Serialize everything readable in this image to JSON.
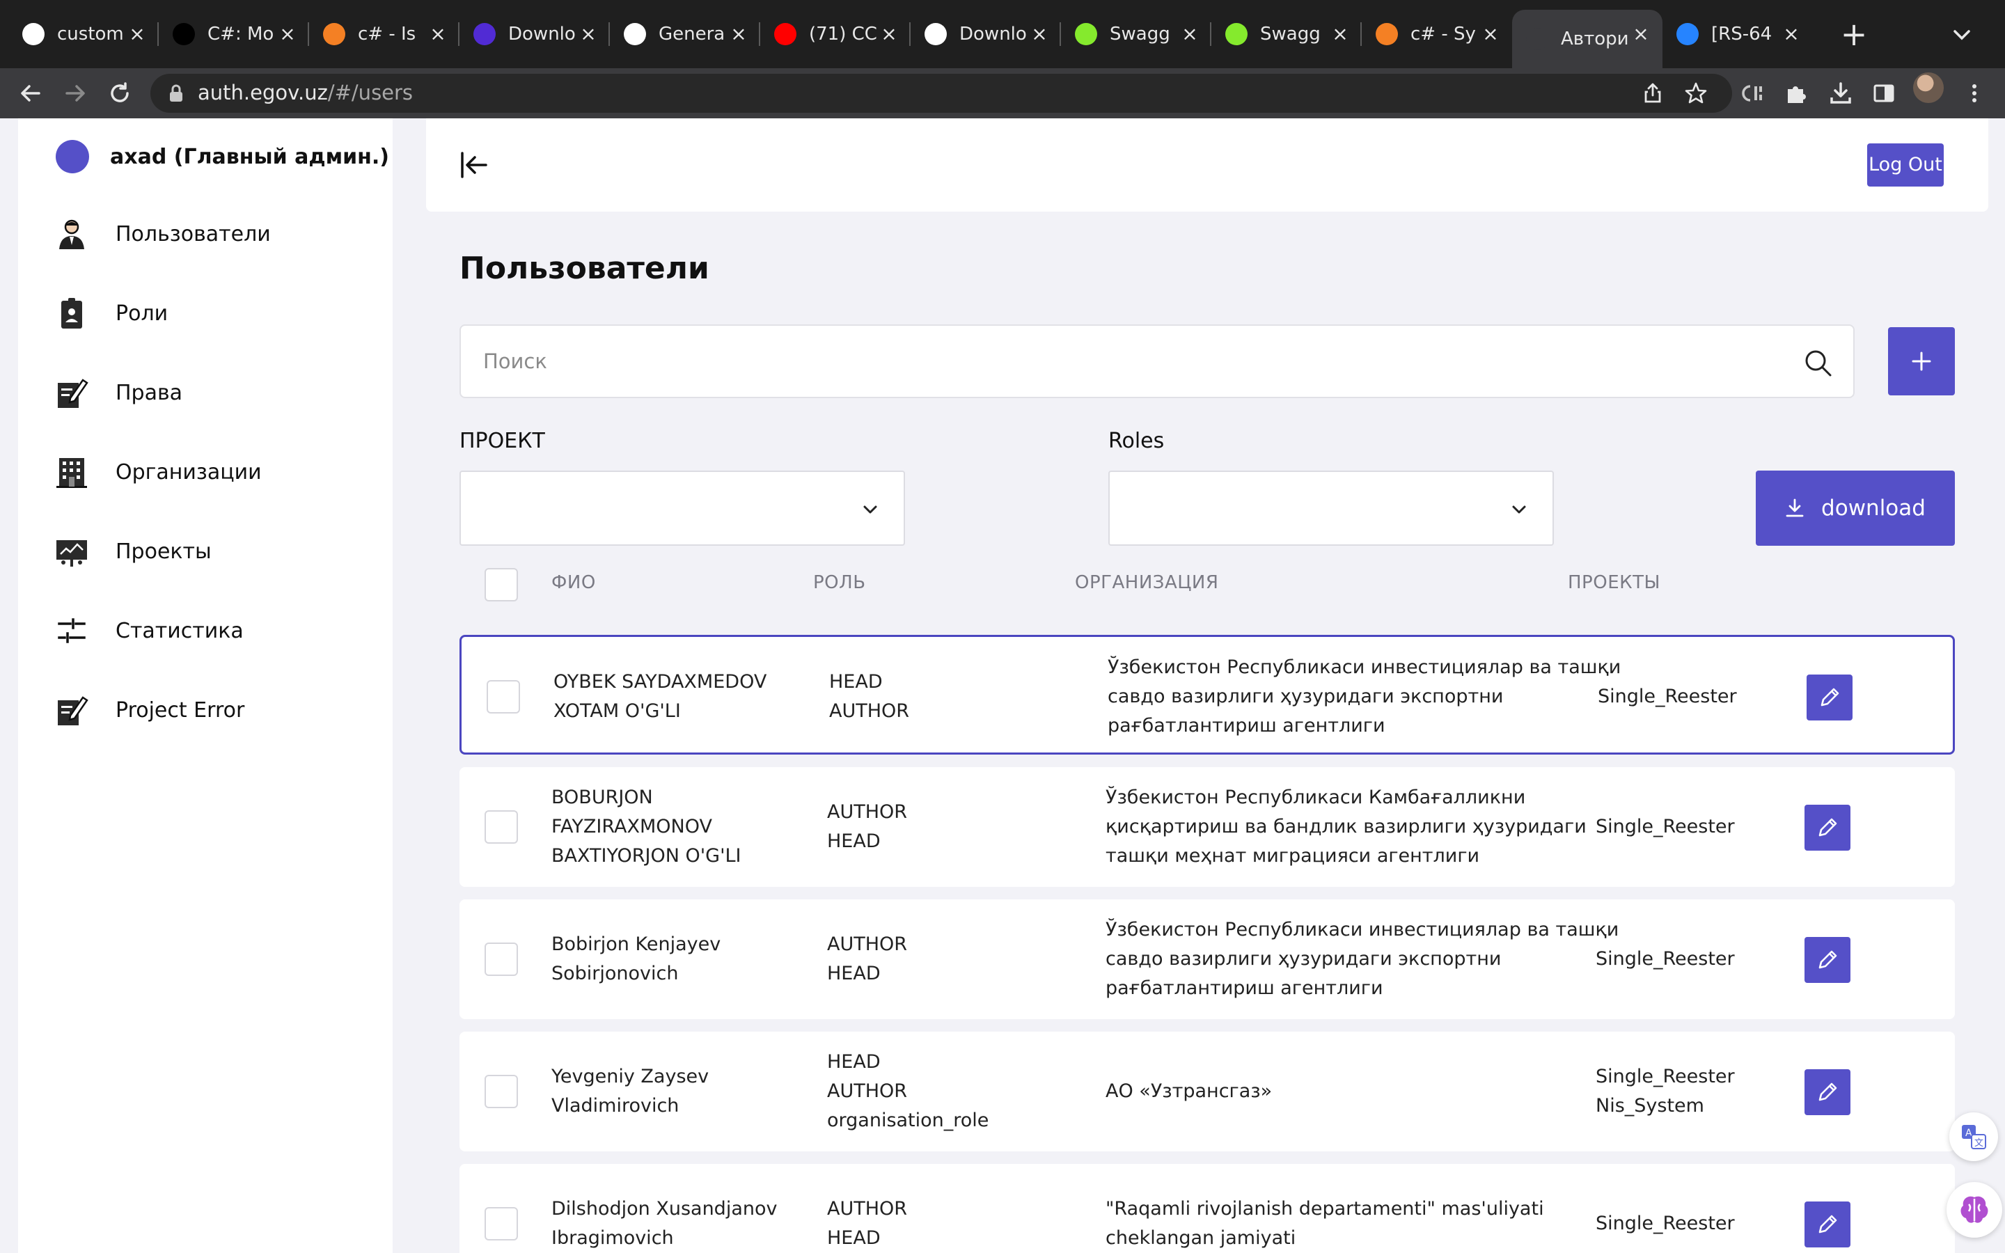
{
  "browser": {
    "tabs": [
      {
        "title": "custom",
        "favicon": "google-icon",
        "color": "#ffffff"
      },
      {
        "title": "C#: Mo",
        "favicon": "dev-icon",
        "color": "#000000"
      },
      {
        "title": "c# - Is",
        "favicon": "stackoverflow-icon",
        "color": "#f48024"
      },
      {
        "title": "Downlo",
        "favicon": "dotnet-icon",
        "color": "#512bd4"
      },
      {
        "title": "Genera",
        "favicon": "github-icon",
        "color": "#ffffff"
      },
      {
        "title": "(71) CC",
        "favicon": "youtube-icon",
        "color": "#ff0000"
      },
      {
        "title": "Downlo",
        "favicon": "postman-icon",
        "color": "#ffffff"
      },
      {
        "title": "Swagg",
        "favicon": "swagger-icon",
        "color": "#85ea2d"
      },
      {
        "title": "Swagg",
        "favicon": "swagger-icon",
        "color": "#85ea2d"
      },
      {
        "title": "c# - Sy",
        "favicon": "stackoverflow-icon",
        "color": "#f48024"
      },
      {
        "title": "Автори",
        "favicon": "asterisk-icon",
        "color": "#3b3b3e"
      },
      {
        "title": "[RS-64",
        "favicon": "jira-icon",
        "color": "#2684ff"
      }
    ],
    "active_tab_index": 10,
    "url_host": "auth.egov.uz",
    "url_path": "/#/users"
  },
  "sidebar": {
    "user_name": "axad (Главный админ.)",
    "items": [
      {
        "label": "Пользователи",
        "icon": "user-icon"
      },
      {
        "label": "Роли",
        "icon": "badge-icon"
      },
      {
        "label": "Права",
        "icon": "edit-document-icon"
      },
      {
        "label": "Организации",
        "icon": "building-icon"
      },
      {
        "label": "Проекты",
        "icon": "presentation-icon"
      },
      {
        "label": "Статистика",
        "icon": "sliders-icon"
      },
      {
        "label": "Project Error",
        "icon": "edit-document-icon"
      }
    ]
  },
  "header": {
    "logout_label": "Log Out"
  },
  "main": {
    "title": "Пользователи",
    "search_placeholder": "Поиск",
    "filter_project_label": "ПРОЕКТ",
    "filter_roles_label": "Roles",
    "download_label": "download",
    "columns": [
      "ФИО",
      "РОЛЬ",
      "ОРГАНИЗАЦИЯ",
      "ПРОЕКТЫ"
    ],
    "rows": [
      {
        "name": [
          "OYBEK SAYDAXMEDOV",
          "XOTAM O'G'LI"
        ],
        "roles": [
          "HEAD",
          "AUTHOR"
        ],
        "org": [
          "Ўзбекистон Республикаси инвестициялар ва ташқи",
          "савдо вазирлиги ҳузуридаги экспортни",
          "рағбатлантириш агентлиги"
        ],
        "projects": [
          "Single_Reester"
        ]
      },
      {
        "name": [
          "BOBURJON",
          "FAYZIRAXMONOV",
          "BAXTIYORJON O'G'LI"
        ],
        "roles": [
          "AUTHOR",
          "HEAD"
        ],
        "org": [
          "Ўзбекистон Республикаси Камбағалликни",
          "қисқартириш ва бандлик вазирлиги ҳузуридаги",
          "ташқи меҳнат миграцияси агентлиги"
        ],
        "projects": [
          "Single_Reester"
        ]
      },
      {
        "name": [
          "Bobirjon Kenjayev",
          "Sobirjonovich"
        ],
        "roles": [
          "AUTHOR",
          "HEAD"
        ],
        "org": [
          "Ўзбекистон Республикаси инвестициялар ва ташқи",
          "савдо вазирлиги ҳузуридаги экспортни",
          "рағбатлантириш агентлиги"
        ],
        "projects": [
          "Single_Reester"
        ]
      },
      {
        "name": [
          "Yevgeniy Zaysev",
          "Vladimirovich"
        ],
        "roles": [
          "HEAD",
          "AUTHOR",
          "organisation_role"
        ],
        "org": [
          "АО «Узтрансгаз»"
        ],
        "projects": [
          "Single_Reester",
          "Nis_System"
        ]
      },
      {
        "name": [
          "Dilshodjon Xusandjanov",
          "Ibragimovich"
        ],
        "roles": [
          "AUTHOR",
          "HEAD"
        ],
        "org": [
          "\"Raqamli rivojlanish departamenti\" mas'uliyati",
          "cheklangan jamiyati"
        ],
        "projects": [
          "Single_Reester"
        ]
      }
    ]
  },
  "colors": {
    "accent": "#5550c8",
    "page_background": "#f2f2f7",
    "selected_row_border": "#4b46c0"
  }
}
